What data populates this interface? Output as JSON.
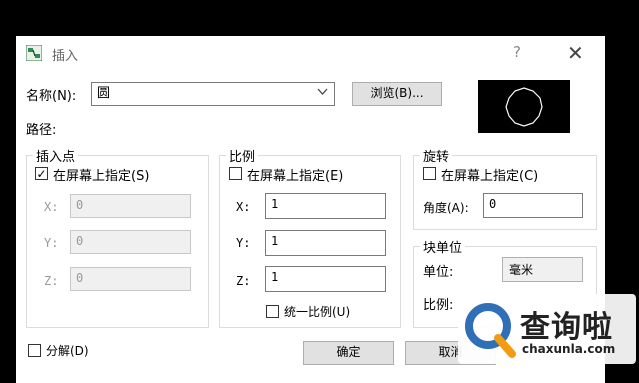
{
  "window": {
    "title": "插入",
    "help": "?",
    "close": "✕"
  },
  "name_row": {
    "label": "名称(N):",
    "value": "圆",
    "browse": "浏览(B)..."
  },
  "path_label": "路径:",
  "insert_point": {
    "title": "插入点",
    "on_screen": "在屏幕上指定(S)",
    "on_screen_checked": true,
    "x_label": "X:",
    "x_value": "0",
    "y_label": "Y:",
    "y_value": "0",
    "z_label": "Z:",
    "z_value": "0"
  },
  "scale": {
    "title": "比例",
    "on_screen": "在屏幕上指定(E)",
    "on_screen_checked": false,
    "x_label": "X:",
    "x_value": "1",
    "y_label": "Y:",
    "y_value": "1",
    "z_label": "Z:",
    "z_value": "1",
    "uniform": "统一比例(U)",
    "uniform_checked": false
  },
  "rotation": {
    "title": "旋转",
    "on_screen": "在屏幕上指定(C)",
    "on_screen_checked": false,
    "angle_label": "角度(A):",
    "angle_value": "0"
  },
  "block_unit": {
    "title": "块单位",
    "unit_label": "单位:",
    "unit_value": "毫米",
    "ratio_label": "比例:"
  },
  "explode": {
    "label": "分解(D)",
    "checked": false
  },
  "buttons": {
    "ok": "确定",
    "cancel": "取消"
  },
  "watermark": {
    "brand": "查询啦",
    "url": "chaxunla.com"
  },
  "colors": {
    "dialog_bg": "#ffffff",
    "screen_bg": "#000000",
    "watermark_blue": "#2f6fb5",
    "watermark_orange": "#f39c12"
  }
}
